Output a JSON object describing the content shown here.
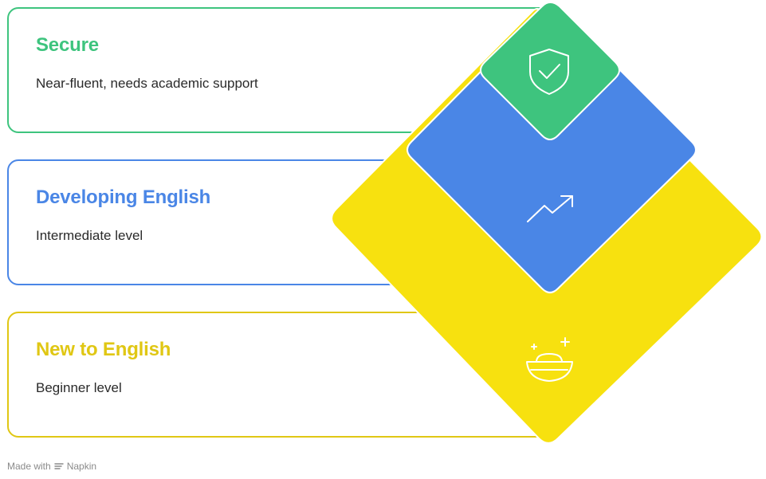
{
  "levels": [
    {
      "title": "Secure",
      "description": "Near-fluent, needs academic support",
      "color": "#3ec47e",
      "icon": "shield-check-icon"
    },
    {
      "title": "Developing English",
      "description": "Intermediate level",
      "color": "#4a86e6",
      "icon": "trending-up-icon"
    },
    {
      "title": "New to English",
      "description": "Beginner level",
      "color": "#f7e10f",
      "title_color": "#e0c714",
      "icon": "gold-ingot-sparkle-icon"
    }
  ],
  "footer": {
    "made_with": "Made with",
    "brand": "Napkin"
  }
}
